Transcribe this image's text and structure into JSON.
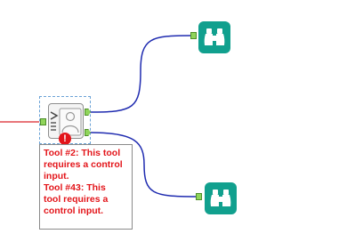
{
  "canvas": {
    "background": "#ffffff",
    "wire_color": "#1f2bb0",
    "incoming_wire_color": "#d9252b"
  },
  "select_tool": {
    "icon": "person-document-icon",
    "input_anchor_color": "#8fd45a",
    "output_anchor_color": "#8fd45a",
    "error_icon": "exclamation-icon",
    "error_badge_glyph": "!"
  },
  "error_message": {
    "color": "#e3151a",
    "lines": [
      "Tool #2: This tool",
      "requires a control",
      "input.",
      "Tool #43: This",
      "tool requires a",
      "control input."
    ]
  },
  "browse_tools": [
    {
      "icon": "binoculars-icon",
      "color": "#11a08e"
    },
    {
      "icon": "binoculars-icon",
      "color": "#11a08e"
    }
  ]
}
